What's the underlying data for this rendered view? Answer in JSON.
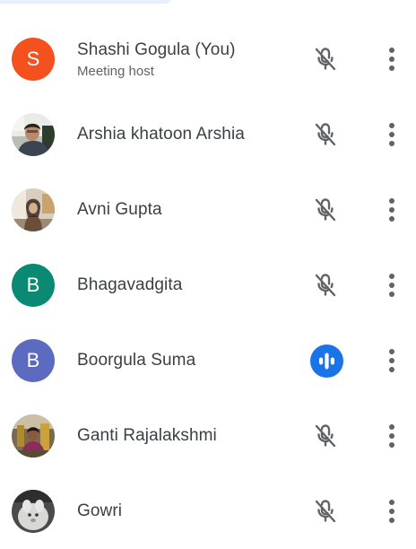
{
  "participants": [
    {
      "name": "Shashi Gogula (You)",
      "subtitle": "Meeting host",
      "avatar_type": "initial",
      "initial": "S",
      "avatar_color": "#f4511e",
      "mic_state": "muted"
    },
    {
      "name": "Arshia khatoon Arshia",
      "subtitle": "",
      "avatar_type": "photo",
      "mic_state": "muted"
    },
    {
      "name": "Avni Gupta",
      "subtitle": "",
      "avatar_type": "photo",
      "mic_state": "muted"
    },
    {
      "name": "Bhagavadgita",
      "subtitle": "",
      "avatar_type": "initial",
      "initial": "B",
      "avatar_color": "#0b8a73",
      "mic_state": "muted"
    },
    {
      "name": "Boorgula Suma",
      "subtitle": "",
      "avatar_type": "initial",
      "initial": "B",
      "avatar_color": "#5c6bc0",
      "mic_state": "speaking"
    },
    {
      "name": "Ganti Rajalakshmi",
      "subtitle": "",
      "avatar_type": "photo",
      "mic_state": "muted"
    },
    {
      "name": "Gowri",
      "subtitle": "",
      "avatar_type": "photo",
      "mic_state": "muted"
    }
  ],
  "icons": {
    "muted": "mic-off-icon",
    "speaking": "audio-level-icon",
    "more": "more-vert-icon"
  },
  "colors": {
    "name_text": "#3c4043",
    "subtitle_text": "#5f6368",
    "icon_gray": "#5f6368",
    "speaking_blue": "#1a73e8"
  }
}
